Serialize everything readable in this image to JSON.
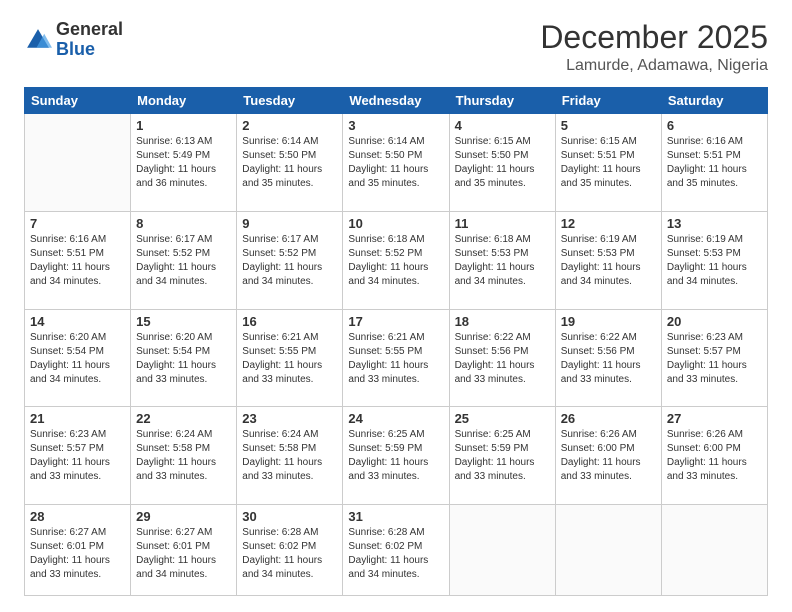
{
  "header": {
    "logo_general": "General",
    "logo_blue": "Blue",
    "month_year": "December 2025",
    "location": "Lamurde, Adamawa, Nigeria"
  },
  "calendar": {
    "days": [
      "Sunday",
      "Monday",
      "Tuesday",
      "Wednesday",
      "Thursday",
      "Friday",
      "Saturday"
    ],
    "weeks": [
      [
        {
          "day": "",
          "info": ""
        },
        {
          "day": "1",
          "info": "Sunrise: 6:13 AM\nSunset: 5:49 PM\nDaylight: 11 hours\nand 36 minutes."
        },
        {
          "day": "2",
          "info": "Sunrise: 6:14 AM\nSunset: 5:50 PM\nDaylight: 11 hours\nand 35 minutes."
        },
        {
          "day": "3",
          "info": "Sunrise: 6:14 AM\nSunset: 5:50 PM\nDaylight: 11 hours\nand 35 minutes."
        },
        {
          "day": "4",
          "info": "Sunrise: 6:15 AM\nSunset: 5:50 PM\nDaylight: 11 hours\nand 35 minutes."
        },
        {
          "day": "5",
          "info": "Sunrise: 6:15 AM\nSunset: 5:51 PM\nDaylight: 11 hours\nand 35 minutes."
        },
        {
          "day": "6",
          "info": "Sunrise: 6:16 AM\nSunset: 5:51 PM\nDaylight: 11 hours\nand 35 minutes."
        }
      ],
      [
        {
          "day": "7",
          "info": "Sunrise: 6:16 AM\nSunset: 5:51 PM\nDaylight: 11 hours\nand 34 minutes."
        },
        {
          "day": "8",
          "info": "Sunrise: 6:17 AM\nSunset: 5:52 PM\nDaylight: 11 hours\nand 34 minutes."
        },
        {
          "day": "9",
          "info": "Sunrise: 6:17 AM\nSunset: 5:52 PM\nDaylight: 11 hours\nand 34 minutes."
        },
        {
          "day": "10",
          "info": "Sunrise: 6:18 AM\nSunset: 5:52 PM\nDaylight: 11 hours\nand 34 minutes."
        },
        {
          "day": "11",
          "info": "Sunrise: 6:18 AM\nSunset: 5:53 PM\nDaylight: 11 hours\nand 34 minutes."
        },
        {
          "day": "12",
          "info": "Sunrise: 6:19 AM\nSunset: 5:53 PM\nDaylight: 11 hours\nand 34 minutes."
        },
        {
          "day": "13",
          "info": "Sunrise: 6:19 AM\nSunset: 5:53 PM\nDaylight: 11 hours\nand 34 minutes."
        }
      ],
      [
        {
          "day": "14",
          "info": "Sunrise: 6:20 AM\nSunset: 5:54 PM\nDaylight: 11 hours\nand 34 minutes."
        },
        {
          "day": "15",
          "info": "Sunrise: 6:20 AM\nSunset: 5:54 PM\nDaylight: 11 hours\nand 33 minutes."
        },
        {
          "day": "16",
          "info": "Sunrise: 6:21 AM\nSunset: 5:55 PM\nDaylight: 11 hours\nand 33 minutes."
        },
        {
          "day": "17",
          "info": "Sunrise: 6:21 AM\nSunset: 5:55 PM\nDaylight: 11 hours\nand 33 minutes."
        },
        {
          "day": "18",
          "info": "Sunrise: 6:22 AM\nSunset: 5:56 PM\nDaylight: 11 hours\nand 33 minutes."
        },
        {
          "day": "19",
          "info": "Sunrise: 6:22 AM\nSunset: 5:56 PM\nDaylight: 11 hours\nand 33 minutes."
        },
        {
          "day": "20",
          "info": "Sunrise: 6:23 AM\nSunset: 5:57 PM\nDaylight: 11 hours\nand 33 minutes."
        }
      ],
      [
        {
          "day": "21",
          "info": "Sunrise: 6:23 AM\nSunset: 5:57 PM\nDaylight: 11 hours\nand 33 minutes."
        },
        {
          "day": "22",
          "info": "Sunrise: 6:24 AM\nSunset: 5:58 PM\nDaylight: 11 hours\nand 33 minutes."
        },
        {
          "day": "23",
          "info": "Sunrise: 6:24 AM\nSunset: 5:58 PM\nDaylight: 11 hours\nand 33 minutes."
        },
        {
          "day": "24",
          "info": "Sunrise: 6:25 AM\nSunset: 5:59 PM\nDaylight: 11 hours\nand 33 minutes."
        },
        {
          "day": "25",
          "info": "Sunrise: 6:25 AM\nSunset: 5:59 PM\nDaylight: 11 hours\nand 33 minutes."
        },
        {
          "day": "26",
          "info": "Sunrise: 6:26 AM\nSunset: 6:00 PM\nDaylight: 11 hours\nand 33 minutes."
        },
        {
          "day": "27",
          "info": "Sunrise: 6:26 AM\nSunset: 6:00 PM\nDaylight: 11 hours\nand 33 minutes."
        }
      ],
      [
        {
          "day": "28",
          "info": "Sunrise: 6:27 AM\nSunset: 6:01 PM\nDaylight: 11 hours\nand 33 minutes."
        },
        {
          "day": "29",
          "info": "Sunrise: 6:27 AM\nSunset: 6:01 PM\nDaylight: 11 hours\nand 34 minutes."
        },
        {
          "day": "30",
          "info": "Sunrise: 6:28 AM\nSunset: 6:02 PM\nDaylight: 11 hours\nand 34 minutes."
        },
        {
          "day": "31",
          "info": "Sunrise: 6:28 AM\nSunset: 6:02 PM\nDaylight: 11 hours\nand 34 minutes."
        },
        {
          "day": "",
          "info": ""
        },
        {
          "day": "",
          "info": ""
        },
        {
          "day": "",
          "info": ""
        }
      ]
    ]
  }
}
